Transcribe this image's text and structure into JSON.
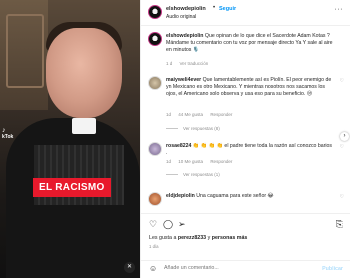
{
  "post": {
    "author": "elshowdepiolin",
    "follow_label": "Seguir",
    "separator": "•",
    "audio": "Audio original",
    "more": "···"
  },
  "video": {
    "overlay_text": "EL RACISMO",
    "watermark_top": "♪",
    "watermark_bottom": "kTok",
    "mute_icon": "speaker-muted-icon"
  },
  "caption": {
    "username": "elshowdepiolin",
    "text": " Que opinan de lo que dice el Sacerdote Adam Kotas ? Mándame tu comentario con tu voz por mensaje directo Ya Y sale al aire en minutos 🎙️"
  },
  "comments": [
    {
      "username": "maiyweli4ever",
      "text": " Que lamentablemente así es Piolín. El peor enemigo de yn Mexicano es otro Mexicano. Y mientras nosotros nos sacamos los ojos, el Americano solo observa y usa eso para su beneficio. 😒",
      "time": "1d",
      "likes": "44 Me gusta",
      "reply": "Responder",
      "replies": "Ver respuestas (8)"
    },
    {
      "username": "rosae8224",
      "text": " 👏 👏 👏 👏 el padre tiene toda la razón así conozco barios .",
      "time": "1d",
      "likes": "10 Me gusta",
      "reply": "Responder",
      "replies": "Ver respuestas (1)"
    },
    {
      "username": "eldjdepiolin",
      "text": " Una caguama para este señor 😂",
      "time": "",
      "likes": "",
      "reply": "",
      "replies": ""
    }
  ],
  "caption_meta": {
    "time": "1 d",
    "translate": "Ver traducción"
  },
  "actions": {
    "likes_prefix": "Les gusta a ",
    "likes_user": "perezz8233",
    "likes_middle": " y ",
    "likes_count": "personas más",
    "date": "1 día"
  },
  "composer": {
    "placeholder": "Añade un comentario...",
    "publish": "Publicar"
  }
}
